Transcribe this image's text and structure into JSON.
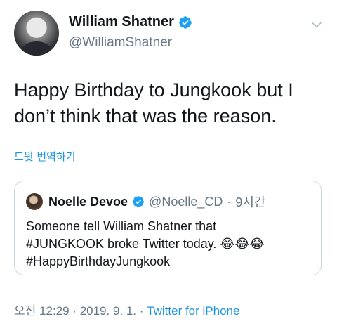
{
  "tweet": {
    "author": {
      "display_name": "William Shatner",
      "handle": "@WilliamShatner",
      "verified": true,
      "avatar_icon": "profile-photo"
    },
    "text": "Happy Birthday to Jungkook but I\ndon’t think that was the reason.",
    "translate_link": "트윗 번역하기",
    "menu_icon": "chevron-down-icon",
    "quoted": {
      "display_name": "Noelle Devoe",
      "handle": "@Noelle_CD",
      "separator": "·",
      "age": "9시간",
      "verified": true,
      "lines": [
        "Someone tell William Shatner that",
        "#JUNGKOOK broke Twitter today. 😂😂😂",
        "#HappyBirthdayJungkook"
      ]
    },
    "footer": {
      "time": "오전 12:29",
      "separator": "·",
      "date": "2019. 9. 1.",
      "source": "Twitter for iPhone"
    }
  },
  "colors": {
    "text": "#14171a",
    "secondary": "#657786",
    "link": "#1b95e0",
    "verified": "#1da1f2",
    "border": "#ccd6dd"
  }
}
